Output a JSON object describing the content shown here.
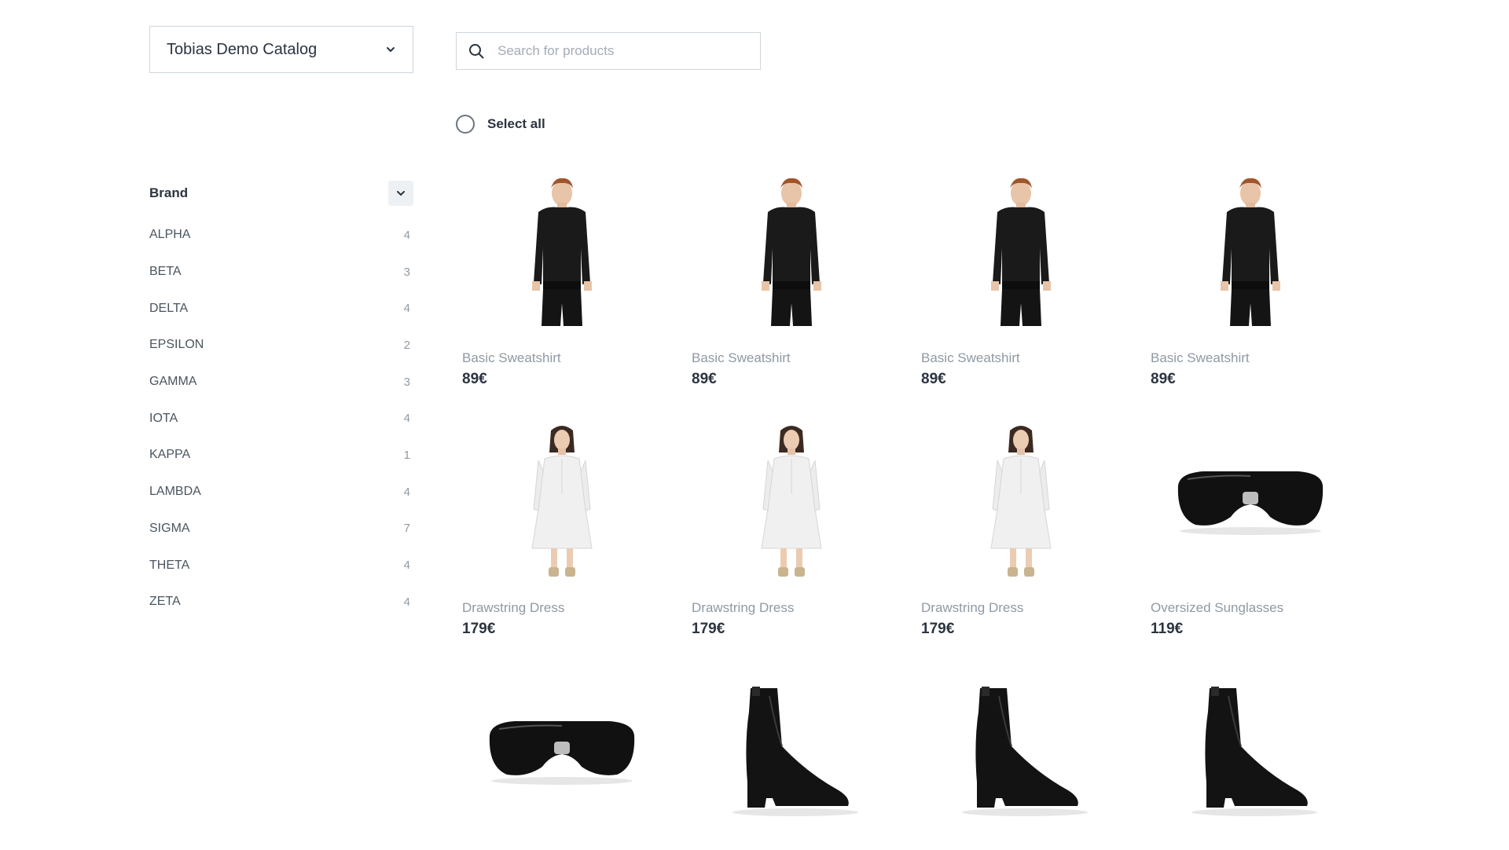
{
  "catalog": {
    "selected": "Tobias Demo Catalog"
  },
  "search": {
    "placeholder": "Search for products",
    "value": ""
  },
  "select_all": {
    "label": "Select all",
    "checked": false
  },
  "filters": {
    "brand": {
      "title": "Brand",
      "items": [
        {
          "label": "ALPHA",
          "count": "4"
        },
        {
          "label": "BETA",
          "count": "3"
        },
        {
          "label": "DELTA",
          "count": "4"
        },
        {
          "label": "EPSILON",
          "count": "2"
        },
        {
          "label": "GAMMA",
          "count": "3"
        },
        {
          "label": "IOTA",
          "count": "4"
        },
        {
          "label": "KAPPA",
          "count": "1"
        },
        {
          "label": "LAMBDA",
          "count": "4"
        },
        {
          "label": "SIGMA",
          "count": "7"
        },
        {
          "label": "THETA",
          "count": "4"
        },
        {
          "label": "ZETA",
          "count": "4"
        }
      ]
    }
  },
  "products": [
    {
      "name": "Basic Sweatshirt",
      "price": "89€",
      "image": "sweatshirt"
    },
    {
      "name": "Basic Sweatshirt",
      "price": "89€",
      "image": "sweatshirt"
    },
    {
      "name": "Basic Sweatshirt",
      "price": "89€",
      "image": "sweatshirt"
    },
    {
      "name": "Basic Sweatshirt",
      "price": "89€",
      "image": "sweatshirt"
    },
    {
      "name": "Drawstring Dress",
      "price": "179€",
      "image": "dress"
    },
    {
      "name": "Drawstring Dress",
      "price": "179€",
      "image": "dress"
    },
    {
      "name": "Drawstring Dress",
      "price": "179€",
      "image": "dress"
    },
    {
      "name": "Oversized Sunglasses",
      "price": "119€",
      "image": "sunglasses"
    },
    {
      "name": "",
      "price": "",
      "image": "sunglasses"
    },
    {
      "name": "",
      "price": "",
      "image": "boot"
    },
    {
      "name": "",
      "price": "",
      "image": "boot"
    },
    {
      "name": "",
      "price": "",
      "image": "boot"
    }
  ],
  "colors": {
    "text": "#2b3440",
    "muted": "#8f99a3",
    "border": "#cfd6dd"
  }
}
